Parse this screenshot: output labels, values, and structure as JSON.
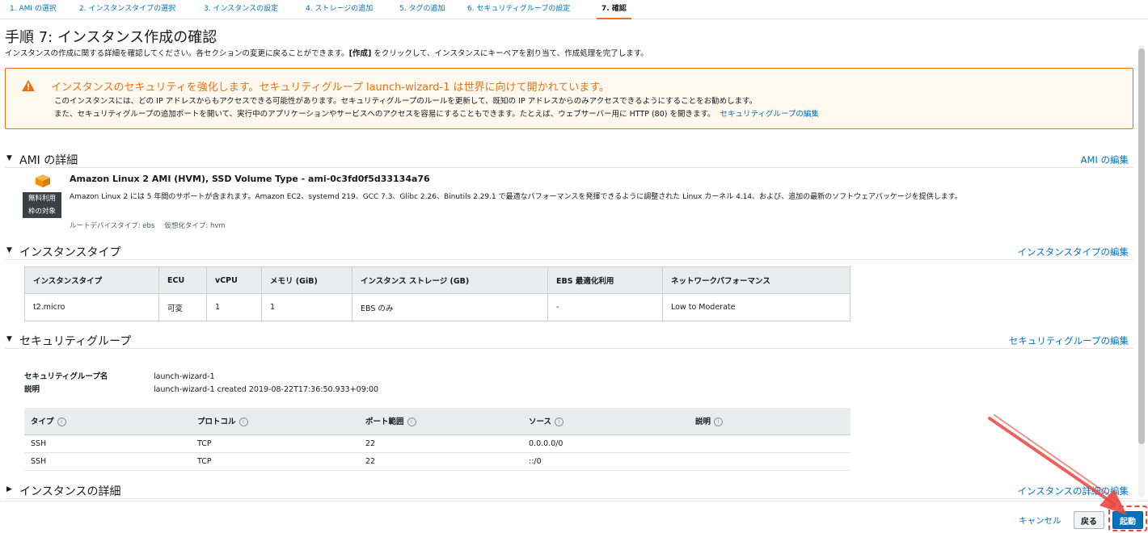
{
  "steps": [
    {
      "label": "1. AMI の選択"
    },
    {
      "label": "2. インスタンスタイプの選択"
    },
    {
      "label": "3. インスタンスの設定"
    },
    {
      "label": "4. ストレージの追加"
    },
    {
      "label": "5. タグの追加"
    },
    {
      "label": "6. セキュリティグループの設定"
    },
    {
      "label": "7. 確認"
    }
  ],
  "page": {
    "title": "手順 7: インスタンス作成の確認",
    "desc_before": "インスタンスの作成に関する詳細を確認してください。各セクションの変更に戻ることができます。",
    "desc_bold": "[作成]",
    "desc_after": " をクリックして、インスタンスにキーペアを割り当て、作成処理を完了します。"
  },
  "warning": {
    "title": "インスタンスのセキュリティを強化します。セキュリティグループ launch-wizard-1 は世界に向けて開かれています。",
    "line1": "このインスタンスには、どの IP アドレスからもアクセスできる可能性があります。セキュリティグループのルールを更新して、既知の IP アドレスからのみアクセスできるようにすることをお勧めします。",
    "line2": "また、セキュリティグループの追加ポートを開いて、実行中のアプリケーションやサービスへのアクセスを容易にすることもできます。たとえば、ウェブサーバー用に HTTP (80) を開きます。",
    "link": "セキュリティグループの編集",
    "color": "#ec7211"
  },
  "ami": {
    "section_title": "AMI の詳細",
    "edit_link": "AMI の編集",
    "name": "Amazon Linux 2 AMI (HVM), SSD Volume Type - ami-0c3fd0f5d33134a76",
    "badge_line1": "無料利用",
    "badge_line2": "枠の対象",
    "description": "Amazon Linux 2 には 5 年間のサポートが含まれます。Amazon EC2、systemd 219、GCC 7.3、Glibc 2.26、Binutils 2.29.1 で最適なパフォーマンスを発揮できるように調整された Linux カーネル 4.14、および、追加の最新のソフトウェアパッケージを提供します。",
    "root_device": "ルートデバイスタイプ: ebs",
    "virtualization": "仮想化タイプ: hvm",
    "icon": "ami-cube-icon"
  },
  "instance_type": {
    "section_title": "インスタンスタイプ",
    "edit_link": "インスタンスタイプの編集",
    "headers": [
      "インスタンスタイプ",
      "ECU",
      "vCPU",
      "メモリ (GiB)",
      "インスタンス ストレージ (GB)",
      "EBS 最適化利用",
      "ネットワークパフォーマンス"
    ],
    "row": [
      "t2.micro",
      "可変",
      "1",
      "1",
      "EBS のみ",
      "-",
      "Low to Moderate"
    ]
  },
  "security_group": {
    "section_title": "セキュリティグループ",
    "edit_link": "セキュリティグループの編集",
    "name_label": "セキュリティグループ名",
    "name_value": "launch-wizard-1",
    "desc_label": "説明",
    "desc_value": "launch-wizard-1 created 2019-08-22T17:36:50.933+09:00",
    "headers": [
      "タイプ",
      "プロトコル",
      "ポート範囲",
      "ソース",
      "説明"
    ],
    "rows": [
      [
        "SSH",
        "TCP",
        "22",
        "0.0.0.0/0",
        ""
      ],
      [
        "SSH",
        "TCP",
        "22",
        "::/0",
        ""
      ]
    ]
  },
  "instance_details": {
    "section_title": "インスタンスの詳細",
    "edit_link": "インスタンスの詳細の編集"
  },
  "footer": {
    "cancel": "キャンセル",
    "back": "戻る",
    "launch": "起動"
  },
  "colors": {
    "link": "#0073bb",
    "primary_button": "#0073bb",
    "warning": "#ec7211",
    "annotation": "#e8473f"
  }
}
